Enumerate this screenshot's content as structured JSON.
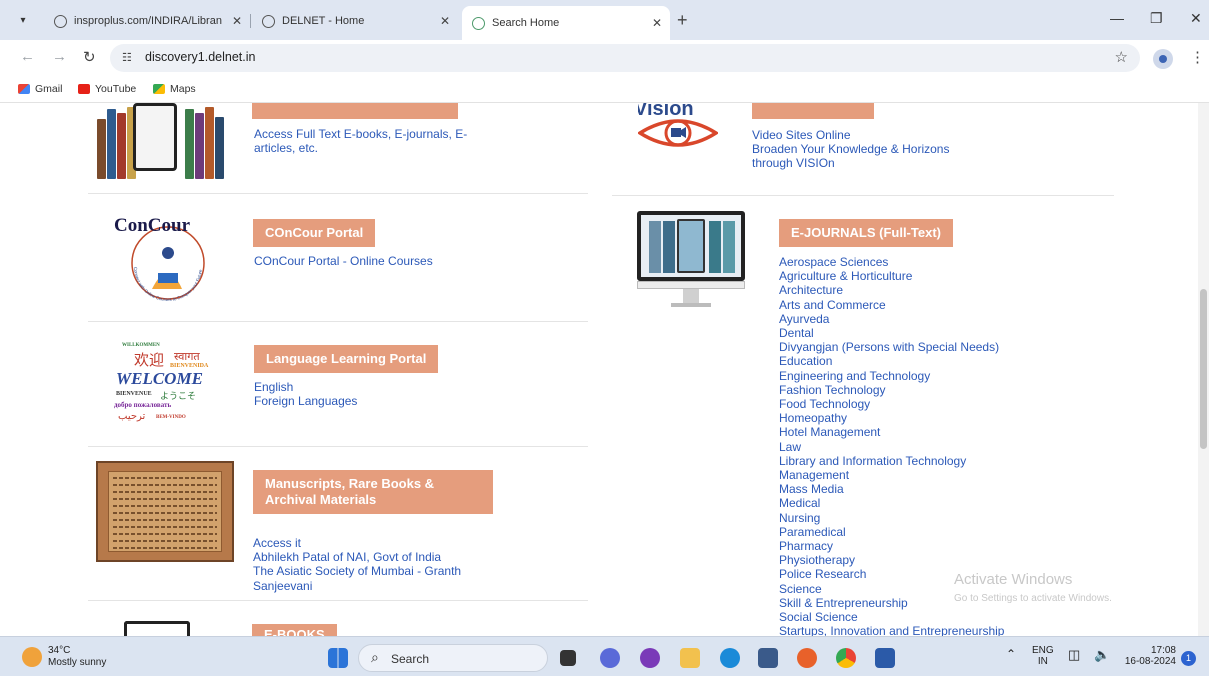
{
  "browser": {
    "tabs": [
      {
        "title": "insproplus.com/INDIRA/Libran",
        "active": false
      },
      {
        "title": "DELNET - Home",
        "active": false
      },
      {
        "title": "Search Home",
        "active": true
      }
    ],
    "url": "discovery1.delnet.in",
    "bookmarks": [
      "Gmail",
      "YouTube",
      "Maps"
    ]
  },
  "page": {
    "ebooks_row": {
      "links": [
        "Access Full Text E-books, E-journals, E-",
        "articles, etc."
      ]
    },
    "vision": {
      "logo_text": "Vision",
      "links": [
        "Video Sites Online",
        "Broaden Your Knowledge & Horizons",
        "through VISIOn"
      ]
    },
    "concour": {
      "title": "COnCour Portal",
      "links": [
        "COnCour Portal - Online Courses"
      ],
      "logo_text": "ConCour",
      "logo_ring_text": "Connect with Online Courses to Conquer your Future Now"
    },
    "language": {
      "title": "Language Learning Portal",
      "links": [
        "English",
        "Foreign Languages"
      ],
      "logo_words": [
        "WILLKOMMEN",
        "欢迎",
        "स्वागत",
        "BIENVENIDA",
        "WELCOME",
        "BIENVENUE",
        "ようこそ",
        "добро пожаловать",
        "ترحيب",
        "BEM-VINDO"
      ]
    },
    "manuscripts": {
      "title_lines": [
        "Manuscripts, Rare Books &",
        "Archival Materials"
      ],
      "links": [
        "Access it",
        "Abhilekh Patal of NAI, Govt of India",
        "The Asiatic Society of Mumbai - Granth",
        "Sanjeevani"
      ]
    },
    "ejournals": {
      "title": "E-JOURNALS (Full-Text)",
      "subjects": [
        "Aerospace Sciences",
        "Agriculture & Horticulture",
        "Architecture",
        "Arts and Commerce",
        "Ayurveda",
        "Dental",
        "Divyangjan (Persons with Special Needs)",
        "Education",
        "Engineering and Technology",
        "Fashion Technology",
        "Food Technology",
        "Homeopathy",
        "Hotel Management",
        "Law",
        "Library and Information Technology",
        "Management",
        "Mass Media",
        "Medical",
        "Nursing",
        "Paramedical",
        "Pharmacy",
        "Physiotherapy",
        "Police Research",
        "Science",
        "Skill & Entrepreneurship",
        "Social Science",
        "Startups, Innovation and Entrepreneurship"
      ]
    },
    "ebooks_bottom": {
      "title": "E-BOOKS"
    },
    "watermark": {
      "title": "Activate Windows",
      "subtitle": "Go to Settings to activate Windows."
    }
  },
  "taskbar": {
    "weather": {
      "temp": "34°C",
      "desc": "Mostly sunny"
    },
    "search_label": "Search",
    "lang": "ENG",
    "region": "IN",
    "time": "17:08",
    "date": "16-08-2024",
    "notification_count": "1"
  },
  "colors": {
    "accent": "#e59d7d",
    "link": "#2c59b8",
    "chrome_bg": "#dfe6f2"
  }
}
